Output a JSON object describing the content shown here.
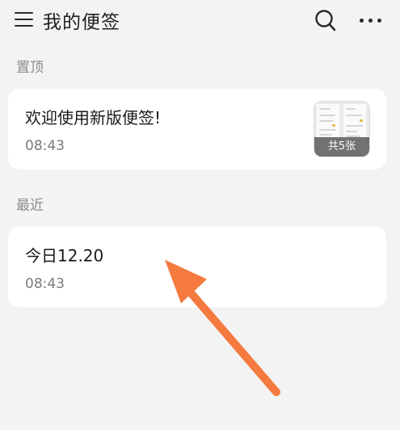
{
  "header": {
    "menu_icon": "hamburger-menu-icon",
    "title": "我的便签",
    "search_icon": "search-icon",
    "more_icon": "more-horizontal-icon"
  },
  "sections": {
    "pinned_label": "置顶",
    "recent_label": "最近"
  },
  "notes": {
    "pinned": {
      "title": "欢迎使用新版便签!",
      "time": "08:43",
      "thumbnail_badge": "共5张"
    },
    "recent": {
      "title": "今日12.20",
      "time": "08:43"
    }
  },
  "annotation": {
    "arrow_color": "#f47a3f"
  }
}
